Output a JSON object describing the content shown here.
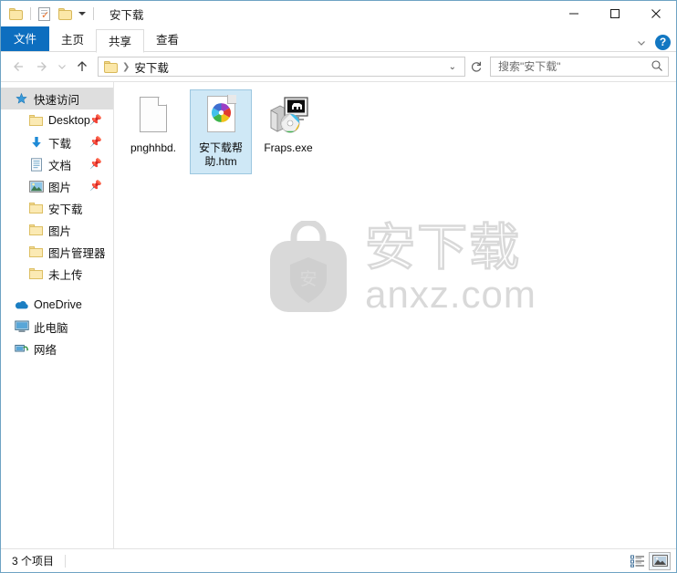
{
  "window": {
    "title": "安下载",
    "quick_access_toolbar": [
      {
        "name": "folder-icon",
        "tooltip": "属性"
      },
      {
        "name": "properties-icon",
        "tooltip": "属性"
      },
      {
        "name": "new-folder-icon",
        "tooltip": "新建文件夹"
      },
      {
        "name": "customize-caret-icon",
        "tooltip": "自定义快速访问工具栏"
      }
    ],
    "controls": {
      "minimize": "—",
      "maximize": "▢",
      "close": "✕"
    }
  },
  "ribbon": {
    "tabs": [
      {
        "label": "文件",
        "state": "file"
      },
      {
        "label": "主页",
        "state": "normal"
      },
      {
        "label": "共享",
        "state": "active"
      },
      {
        "label": "查看",
        "state": "normal"
      }
    ],
    "collapse_icon": "chevron-down-icon",
    "help_label": "?"
  },
  "address": {
    "back_icon": "arrow-left-icon",
    "forward_icon": "arrow-right-icon",
    "recent_icon": "chevron-down-icon",
    "up_icon": "arrow-up-icon",
    "breadcrumb": [
      {
        "label": "安下载"
      }
    ],
    "dropdown_caret": "⌄",
    "refresh_icon": "refresh-icon"
  },
  "search": {
    "placeholder": "搜索\"安下载\"",
    "value": "",
    "icon": "search-icon"
  },
  "sidebar": {
    "items": [
      {
        "label": "快速访问",
        "icon": "star-pin-icon",
        "selected": true,
        "level": "root",
        "pinned": false
      },
      {
        "label": "Desktop",
        "icon": "folder-icon",
        "selected": false,
        "level": "indent",
        "pinned": true
      },
      {
        "label": "下载",
        "icon": "download-icon",
        "selected": false,
        "level": "indent",
        "pinned": true
      },
      {
        "label": "文档",
        "icon": "documents-icon",
        "selected": false,
        "level": "indent",
        "pinned": true
      },
      {
        "label": "图片",
        "icon": "pictures-icon",
        "selected": false,
        "level": "indent",
        "pinned": true
      },
      {
        "label": "安下载",
        "icon": "folder-icon",
        "selected": false,
        "level": "indent",
        "pinned": false
      },
      {
        "label": "图片",
        "icon": "folder-icon",
        "selected": false,
        "level": "indent",
        "pinned": false
      },
      {
        "label": "图片管理器",
        "icon": "folder-icon",
        "selected": false,
        "level": "indent",
        "pinned": false
      },
      {
        "label": "未上传",
        "icon": "folder-icon",
        "selected": false,
        "level": "indent",
        "pinned": false
      },
      {
        "label": "OneDrive",
        "icon": "onedrive-icon",
        "selected": false,
        "level": "root",
        "pinned": false
      },
      {
        "label": "此电脑",
        "icon": "this-pc-icon",
        "selected": false,
        "level": "root",
        "pinned": false
      },
      {
        "label": "网络",
        "icon": "network-icon",
        "selected": false,
        "level": "root",
        "pinned": false
      }
    ]
  },
  "files": [
    {
      "name": "pnghhbd.",
      "icon": "blank-document-icon",
      "selected": false
    },
    {
      "name": "安下载帮助.htm",
      "icon": "html-pinwheel-icon",
      "selected": true
    },
    {
      "name": "Fraps.exe",
      "icon": "fraps-application-icon",
      "selected": false
    }
  ],
  "watermark": {
    "brand_text": "安下载",
    "domain_text": "anxz.com",
    "shield_char": "安",
    "color": "#d8d8d8"
  },
  "statusbar": {
    "item_count_text": "3 个项目",
    "views": [
      {
        "name": "details-view-button",
        "active": false
      },
      {
        "name": "large-icons-view-button",
        "active": true
      }
    ]
  },
  "colors": {
    "accent": "#0d6ebf",
    "selection_fill": "#cfe8f6",
    "selection_border": "#9cc7e0",
    "sidebar_selected": "#dedede",
    "window_border": "#6ea3c4"
  }
}
